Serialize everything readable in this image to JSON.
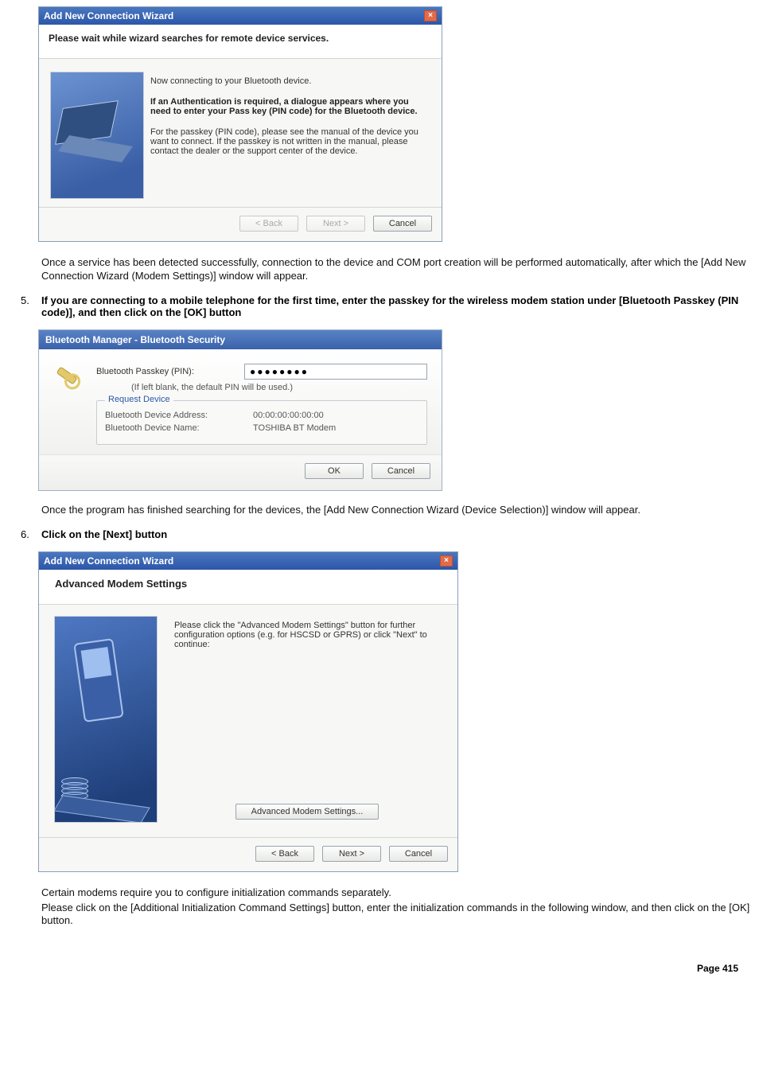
{
  "wizard1": {
    "title": "Add New Connection Wizard",
    "subtitle": "Please wait while wizard searches for remote device services.",
    "line1": "Now connecting to your Bluetooth device.",
    "bold": "If an Authentication is required, a dialogue appears where you need to enter your Pass key (PIN code) for the Bluetooth device.",
    "line2": "For the passkey (PIN code), please see the manual of the device you want to connect. If the passkey is not written in the manual, please contact the dealer or the support center of the device.",
    "back": "< Back",
    "next": "Next >",
    "cancel": "Cancel"
  },
  "para1": "Once a service has been detected successfully, connection to the device and COM port creation will be performed automatically, after which the [Add New Connection Wizard (Modem Settings)] window will appear.",
  "step5": {
    "num": "5.",
    "text": "If you are connecting to a mobile telephone for the first time, enter the passkey for the wireless modem station under [Bluetooth Passkey (PIN code)], and then click on the [OK] button"
  },
  "security": {
    "title": "Bluetooth Manager - Bluetooth Security",
    "passkey_label": "Bluetooth Passkey (PIN):",
    "passkey_value": "●●●●●●●●",
    "hint": "(If left blank, the default PIN will be used.)",
    "fieldset_legend": "Request Device",
    "addr_label": "Bluetooth Device Address:",
    "addr_value": "00:00:00:00:00:00",
    "name_label": "Bluetooth Device Name:",
    "name_value": "TOSHIBA BT Modem",
    "ok": "OK",
    "cancel": "Cancel"
  },
  "para2": "Once the program has finished searching for the devices, the [Add New Connection Wizard (Device Selection)] window will appear.",
  "step6": {
    "num": "6.",
    "text": "Click on the [Next] button"
  },
  "wizard2": {
    "title": "Add New Connection Wizard",
    "subtitle": "Advanced Modem Settings",
    "body": "Please click the \"Advanced Modem Settings\" button for further configuration options (e.g. for HSCSD or GPRS) or click \"Next\" to continue:",
    "adv_btn": "Advanced Modem Settings...",
    "back": "< Back",
    "next": "Next >",
    "cancel": "Cancel"
  },
  "para3a": "Certain modems require you to configure initialization commands separately.",
  "para3b": "Please click on the [Additional Initialization Command Settings] button, enter the initialization commands in the following window, and then click on the [OK] button.",
  "footer": "Page 415"
}
